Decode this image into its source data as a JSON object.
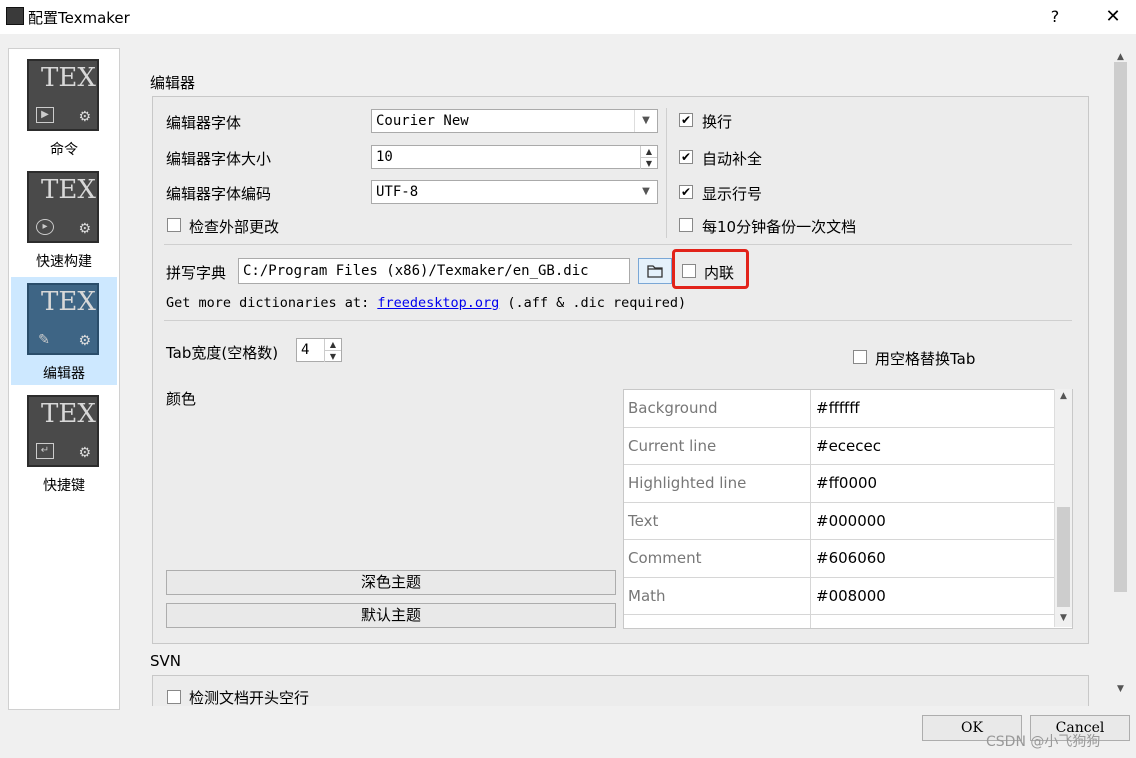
{
  "window": {
    "title": "配置Texmaker",
    "help": "?",
    "close": "✕"
  },
  "sidebar": {
    "items": [
      {
        "label": "命令",
        "icon": "tex-command-icon"
      },
      {
        "label": "快速构建",
        "icon": "tex-quickbuild-icon"
      },
      {
        "label": "编辑器",
        "icon": "tex-editor-icon",
        "selected": true
      },
      {
        "label": "快捷键",
        "icon": "tex-shortcuts-icon"
      }
    ],
    "tex_text": "TEX"
  },
  "editor": {
    "section_title": "编辑器",
    "font_label": "编辑器字体",
    "font_value": "Courier New",
    "size_label": "编辑器字体大小",
    "size_value": "10",
    "encoding_label": "编辑器字体编码",
    "encoding_value": "UTF-8",
    "check_external_label": "检查外部更改",
    "wrap_label": "换行",
    "autocomplete_label": "自动补全",
    "line_numbers_label": "显示行号",
    "backup_label": "每10分钟备份一次文档",
    "dict_label": "拼写字典",
    "dict_value": "C:/Program Files (x86)/Texmaker/en_GB.dic",
    "inline_label": "内联",
    "dict_hint_prefix": "Get more dictionaries at: ",
    "dict_link": "freedesktop.org",
    "dict_hint_suffix": " (.aff & .dic required)",
    "tab_label": "Tab宽度(空格数)",
    "tab_value": "4",
    "spaces_label": "用空格替换Tab",
    "color_label": "颜色",
    "dark_theme_button": "深色主题",
    "default_theme_button": "默认主题",
    "colors": [
      {
        "name": "Background",
        "value": "#ffffff"
      },
      {
        "name": "Current line",
        "value": "#ececec"
      },
      {
        "name": "Highlighted line",
        "value": "#ff0000"
      },
      {
        "name": "Text",
        "value": "#000000"
      },
      {
        "name": "Comment",
        "value": "#606060"
      },
      {
        "name": "Math",
        "value": "#008000"
      }
    ]
  },
  "svn": {
    "title": "SVN",
    "check_label": "检测文档开头空行"
  },
  "footer": {
    "ok": "OK",
    "cancel": "Cancel",
    "watermark": "CSDN @小飞狗狗"
  },
  "colors": {
    "highlight": "#e2231a",
    "selection": "#cde8ff",
    "link": "#0000ee"
  }
}
